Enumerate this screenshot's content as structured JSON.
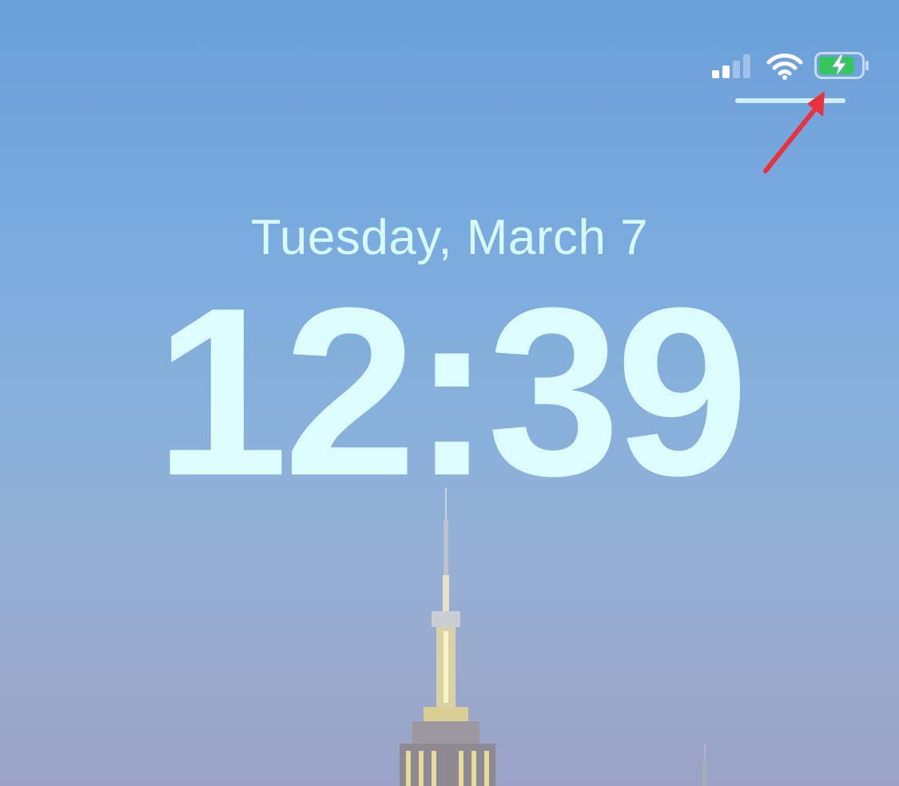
{
  "lock_screen": {
    "date": "Tuesday, March 7",
    "time": "12:39"
  },
  "status_bar": {
    "icons": [
      "cellular-signal-icon",
      "wifi-icon",
      "battery-charging-icon"
    ],
    "signal_bars_active": 2,
    "signal_bars_total": 4,
    "battery_fill_fraction": 0.85,
    "battery_fill_color": "#35c759",
    "charging": true
  },
  "annotation": {
    "arrow_color": "#e8323c"
  },
  "colors": {
    "text": "#d6fbff",
    "sky_top": "#6b9fd9",
    "sky_bottom": "#9aa3c6"
  }
}
